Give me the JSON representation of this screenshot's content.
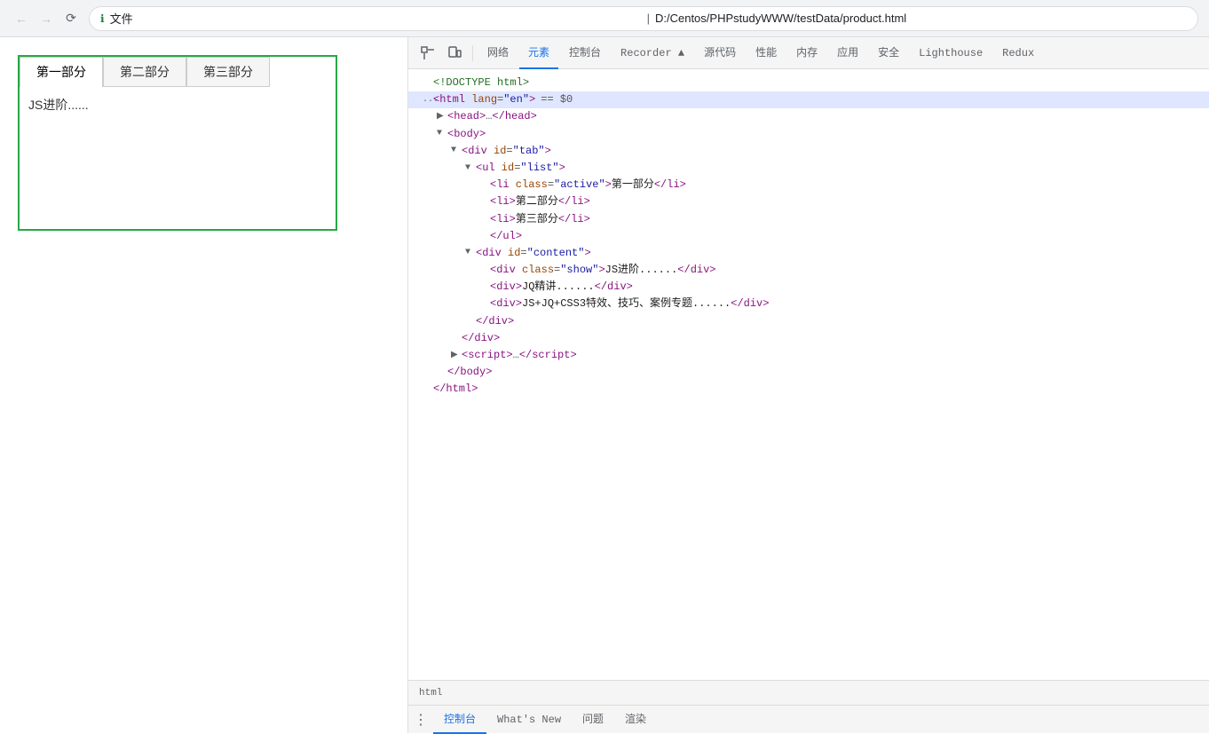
{
  "browser": {
    "back_disabled": true,
    "forward_disabled": true,
    "security_label": "文件",
    "address": "D:/Centos/PHPstudyWWW/testData/product.html"
  },
  "preview": {
    "tabs": [
      {
        "id": "tab1",
        "label": "第一部分",
        "active": true
      },
      {
        "id": "tab2",
        "label": "第二部分",
        "active": false
      },
      {
        "id": "tab3",
        "label": "第三部分",
        "active": false
      }
    ],
    "active_content": "JS进阶......"
  },
  "devtools": {
    "toolbar_tabs": [
      {
        "id": "elements-picker",
        "label": "⬚",
        "icon": true
      },
      {
        "id": "device-toggle",
        "label": "⬜",
        "icon": true
      },
      {
        "id": "network-tab",
        "label": "网络"
      },
      {
        "id": "elements-tab",
        "label": "元素",
        "active": true
      },
      {
        "id": "console-tab",
        "label": "控制台"
      },
      {
        "id": "recorder-tab",
        "label": "Recorder ▲"
      },
      {
        "id": "sources-tab",
        "label": "源代码"
      },
      {
        "id": "performance-tab",
        "label": "性能"
      },
      {
        "id": "memory-tab",
        "label": "内存"
      },
      {
        "id": "application-tab",
        "label": "应用"
      },
      {
        "id": "security-tab",
        "label": "安全"
      },
      {
        "id": "lighthouse-tab",
        "label": "Lighthouse"
      },
      {
        "id": "redux-tab",
        "label": "Redux"
      }
    ],
    "html_tree": [
      {
        "indent": 0,
        "content": "<!DOCTYPE html>",
        "type": "comment",
        "toggle": ""
      },
      {
        "indent": 0,
        "content": "html_selected",
        "type": "selected",
        "toggle": "▶"
      },
      {
        "indent": 1,
        "content": "head_collapsed",
        "type": "collapsed",
        "toggle": "▶"
      },
      {
        "indent": 1,
        "content": "body_open",
        "type": "tag",
        "toggle": "▼"
      },
      {
        "indent": 2,
        "content": "div_tab",
        "type": "tag",
        "toggle": "▼"
      },
      {
        "indent": 3,
        "content": "ul_list",
        "type": "tag",
        "toggle": "▼"
      },
      {
        "indent": 4,
        "content": "li_active",
        "type": "tag",
        "toggle": ""
      },
      {
        "indent": 4,
        "content": "li_2",
        "type": "tag",
        "toggle": ""
      },
      {
        "indent": 4,
        "content": "li_3",
        "type": "tag",
        "toggle": ""
      },
      {
        "indent": 3,
        "content": "ul_close",
        "type": "close",
        "toggle": ""
      },
      {
        "indent": 3,
        "content": "div_content",
        "type": "tag",
        "toggle": "▼"
      },
      {
        "indent": 4,
        "content": "div_show",
        "type": "tag",
        "toggle": ""
      },
      {
        "indent": 4,
        "content": "div_jq",
        "type": "tag",
        "toggle": ""
      },
      {
        "indent": 4,
        "content": "div_js",
        "type": "tag",
        "toggle": ""
      },
      {
        "indent": 3,
        "content": "div_close2",
        "type": "close",
        "toggle": ""
      },
      {
        "indent": 2,
        "content": "div_close3",
        "type": "close",
        "toggle": ""
      },
      {
        "indent": 1,
        "content": "script_collapsed",
        "type": "collapsed",
        "toggle": "▶"
      },
      {
        "indent": 1,
        "content": "body_close",
        "type": "close",
        "toggle": ""
      },
      {
        "indent": 0,
        "content": "html_close",
        "type": "close",
        "toggle": ""
      }
    ],
    "breadcrumb": "html",
    "bottom_tabs": [
      {
        "id": "console",
        "label": "控制台",
        "active": true
      },
      {
        "id": "whatsnew",
        "label": "What's New"
      },
      {
        "id": "issues",
        "label": "问题"
      },
      {
        "id": "render",
        "label": "渲染"
      }
    ]
  }
}
